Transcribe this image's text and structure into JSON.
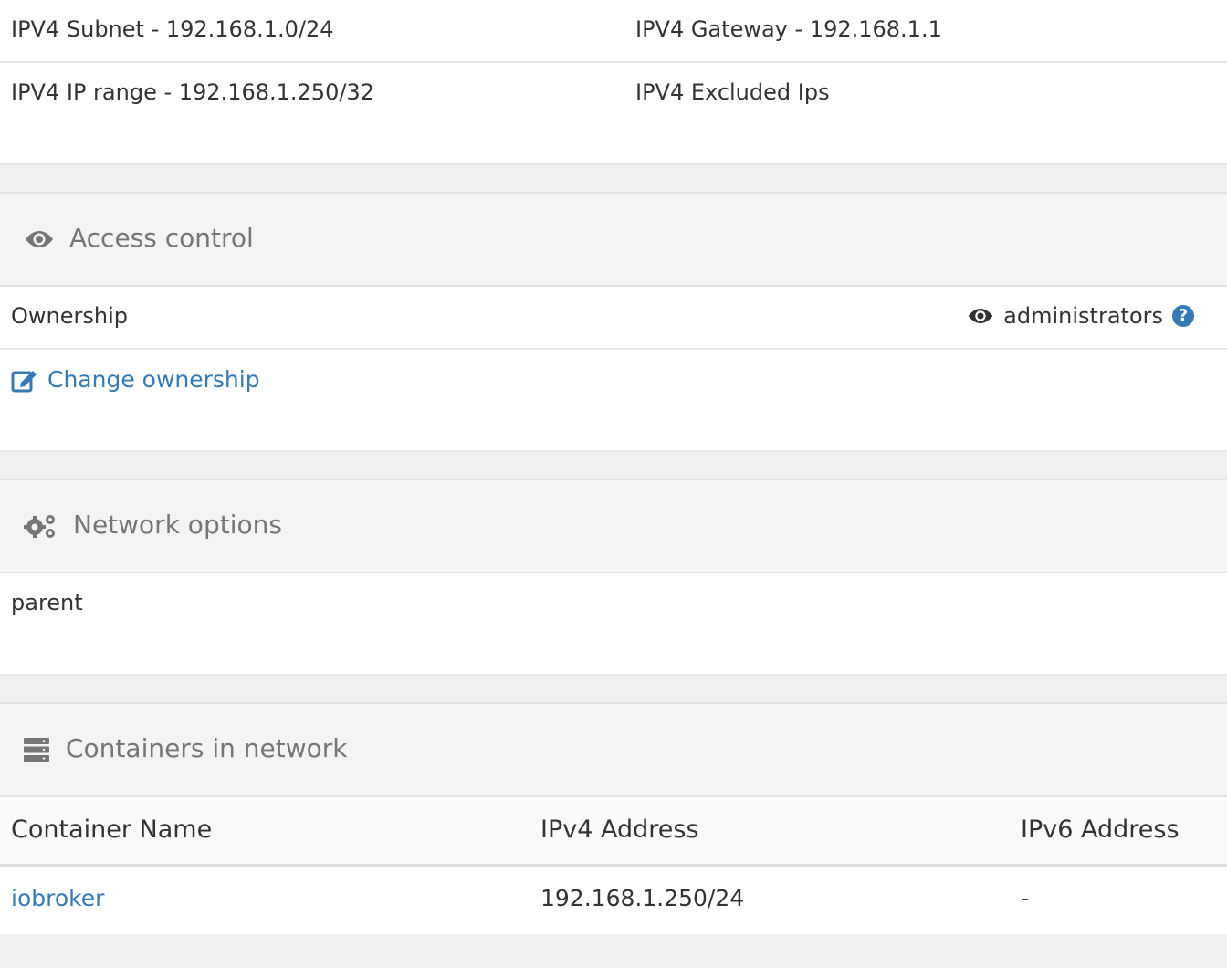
{
  "ipv4": {
    "subnet": "IPV4 Subnet - 192.168.1.0/24",
    "gateway": "IPV4 Gateway - 192.168.1.1",
    "ip_range": "IPV4 IP range - 192.168.1.250/32",
    "excluded": "IPV4 Excluded Ips"
  },
  "access_control": {
    "title": "Access control",
    "ownership_label": "Ownership",
    "ownership_value": "administrators",
    "help_glyph": "?",
    "change_ownership": "Change ownership"
  },
  "network_options": {
    "title": "Network options",
    "options": [
      "parent"
    ]
  },
  "containers": {
    "title": "Containers in network",
    "columns": [
      "Container Name",
      "IPv4 Address",
      "IPv6 Address"
    ],
    "rows": [
      [
        "iobroker",
        "192.168.1.250/24",
        "-"
      ]
    ]
  },
  "colors": {
    "link": "#337ab7",
    "section_title": "#767676",
    "text": "#333333"
  },
  "icons": {
    "access_control": "eye-icon",
    "ownership": "eye-icon",
    "help": "question-circle-icon",
    "change_ownership": "edit-icon",
    "network_options": "cogs-icon",
    "containers": "server-icon"
  }
}
